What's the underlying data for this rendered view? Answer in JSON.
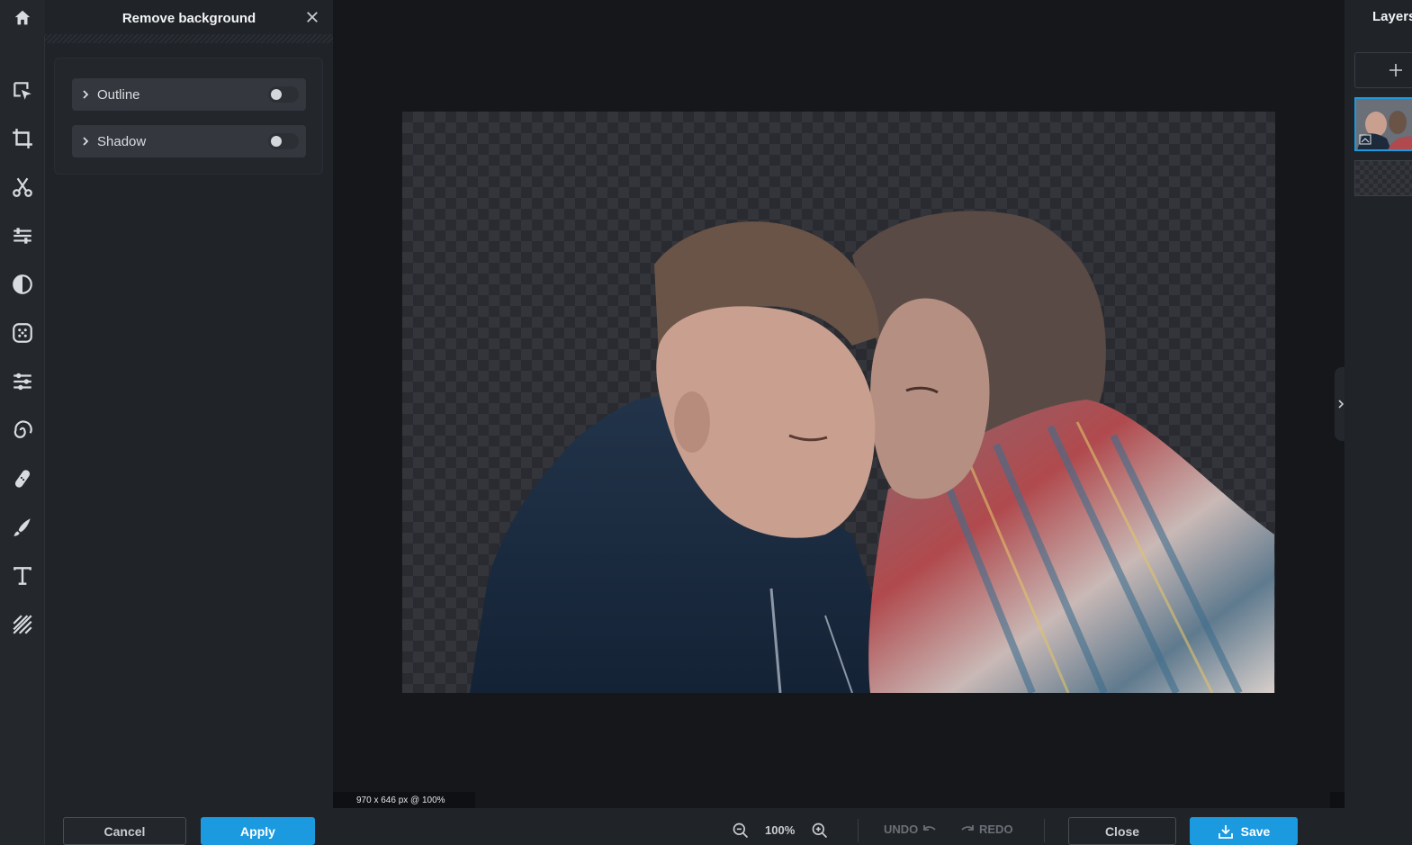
{
  "panel": {
    "title": "Remove background",
    "options": [
      {
        "label": "Outline",
        "enabled": false
      },
      {
        "label": "Shadow",
        "enabled": false
      }
    ],
    "cancel_label": "Cancel",
    "apply_label": "Apply"
  },
  "toolbar": {
    "icons": [
      "home-icon",
      "arrange-icon",
      "crop-icon",
      "cutout-icon",
      "adjust-icon",
      "effects-icon",
      "filters-icon",
      "retouch-icon",
      "liquify-icon",
      "heal-icon",
      "draw-icon",
      "text-icon",
      "pattern-icon"
    ]
  },
  "canvas": {
    "size_info": "970 x 646 px @ 100%"
  },
  "layers": {
    "title": "Layers"
  },
  "bottom_bar": {
    "zoom_level": "100%",
    "undo_label": "UNDO",
    "redo_label": "REDO",
    "close_label": "Close",
    "save_label": "Save"
  },
  "colors": {
    "accent": "#1b9ae0",
    "background": "#16171b",
    "panel": "#202328"
  }
}
